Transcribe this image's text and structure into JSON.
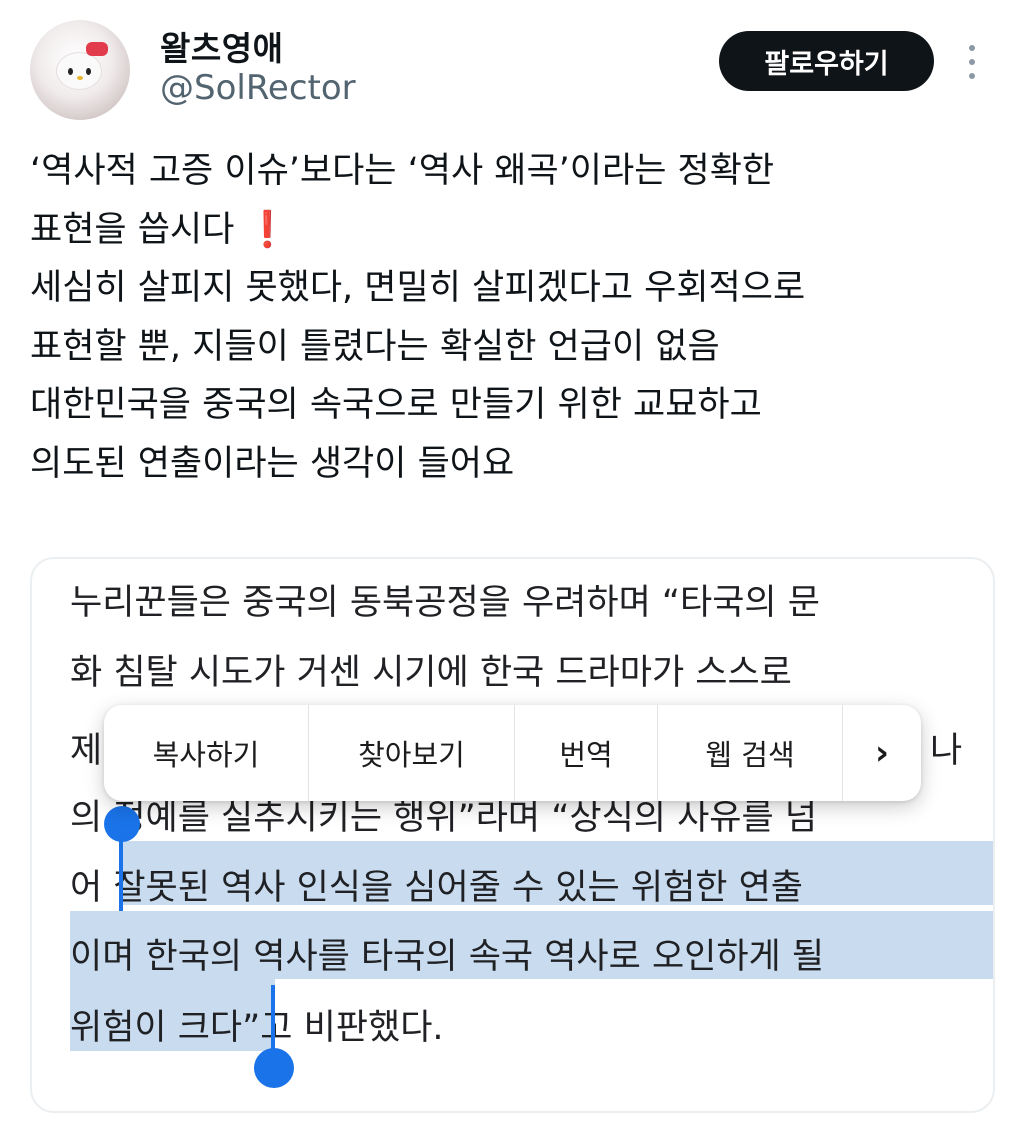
{
  "user": {
    "display_name": "왈츠영애",
    "handle": "@SolRector"
  },
  "actions": {
    "follow_label": "팔로우하기"
  },
  "tweet": {
    "lines": [
      "‘역사적 고증 이슈’보다는 ‘역사 왜곡’이라는 정확한",
      "표현을 씁시다",
      "세심히 살피지 못했다, 면밀히 살피겠다고 우회적으로",
      "표현할 뿐, 지들이 틀렸다는 확실한 언급이 없음",
      "대한민국을 중국의 속국으로 만들기 위한 교묘하고",
      "의도된 연출이라는 생각이 들어요"
    ],
    "emoji": "❗"
  },
  "card": {
    "line1": "누리꾼들은 중국의 동북공정을 우려하며 “타국의 문",
    "line2": "화 침탈 시도가 거센 시기에 한국 드라마가 스스로",
    "line3_left": "제",
    "line3_right": "나",
    "line4": "의 정예를 실추시키는 행위”라며 “상식의 사유를 넘",
    "line5_plain": "어 ",
    "line5_selected": "잘못된 역사 인식을 심어줄 수 있는 위험한 연출",
    "line6_selected": "이며 한국의 역사를 타국의 속국 역사로 오인하게 될",
    "line7_selected": "위험이 크다",
    "line7_plain": "”고 비판했다."
  },
  "context_menu": {
    "items": [
      "복사하기",
      "찾아보기",
      "번역",
      "웹 검색"
    ],
    "more": "›"
  },
  "icons": {
    "more": "more-vertical-icon",
    "overflow": "chevron-right-icon"
  },
  "colors": {
    "follow_bg": "#0f1419",
    "selection": "#c9dcef",
    "selection_handle": "#1a73e8",
    "emoji_red": "#e0313a"
  }
}
